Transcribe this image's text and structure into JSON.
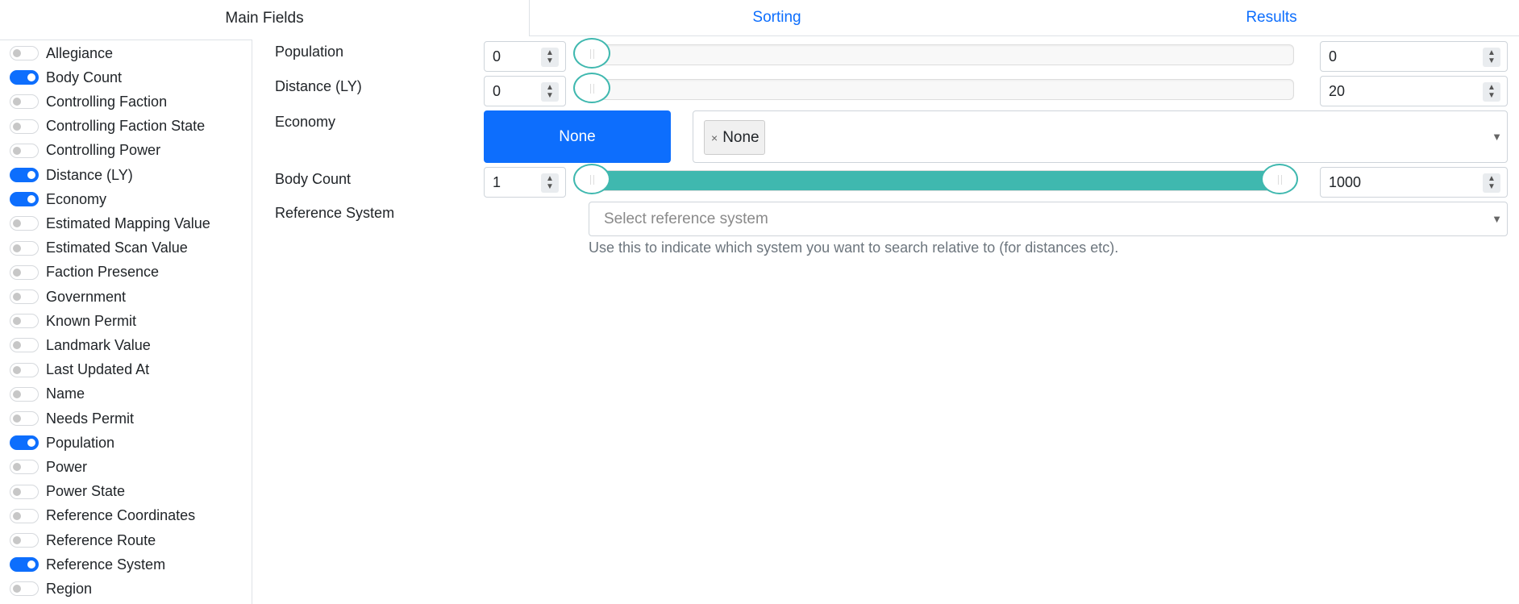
{
  "tabs": {
    "main_fields": "Main Fields",
    "sorting": "Sorting",
    "results": "Results"
  },
  "sidebar": {
    "items": [
      {
        "label": "Allegiance",
        "on": false
      },
      {
        "label": "Body Count",
        "on": true
      },
      {
        "label": "Controlling Faction",
        "on": false
      },
      {
        "label": "Controlling Faction State",
        "on": false
      },
      {
        "label": "Controlling Power",
        "on": false
      },
      {
        "label": "Distance (LY)",
        "on": true
      },
      {
        "label": "Economy",
        "on": true
      },
      {
        "label": "Estimated Mapping Value",
        "on": false
      },
      {
        "label": "Estimated Scan Value",
        "on": false
      },
      {
        "label": "Faction Presence",
        "on": false
      },
      {
        "label": "Government",
        "on": false
      },
      {
        "label": "Known Permit",
        "on": false
      },
      {
        "label": "Landmark Value",
        "on": false
      },
      {
        "label": "Last Updated At",
        "on": false
      },
      {
        "label": "Name",
        "on": false
      },
      {
        "label": "Needs Permit",
        "on": false
      },
      {
        "label": "Population",
        "on": true
      },
      {
        "label": "Power",
        "on": false
      },
      {
        "label": "Power State",
        "on": false
      },
      {
        "label": "Reference Coordinates",
        "on": false
      },
      {
        "label": "Reference Route",
        "on": false
      },
      {
        "label": "Reference System",
        "on": true
      },
      {
        "label": "Region",
        "on": false
      }
    ]
  },
  "fields": {
    "population": {
      "label": "Population",
      "min": "0",
      "max": "0"
    },
    "distance": {
      "label": "Distance (LY)",
      "min": "0",
      "max": "20"
    },
    "economy": {
      "label": "Economy",
      "button": "None",
      "tag_remove": "×",
      "tag": "None"
    },
    "body_count": {
      "label": "Body Count",
      "min": "1",
      "max": "1000",
      "range_low_fraction": 0,
      "range_high_fraction": 1
    },
    "reference_system": {
      "label": "Reference System",
      "placeholder": "Select reference system",
      "help": "Use this to indicate which system you want to search relative to (for distances etc)."
    }
  },
  "icons": {
    "spinner_up": "▲",
    "spinner_down": "▼",
    "dropdown_caret": "▼"
  },
  "colors": {
    "accent": "#0d6efd",
    "slider": "#3fb8af"
  }
}
